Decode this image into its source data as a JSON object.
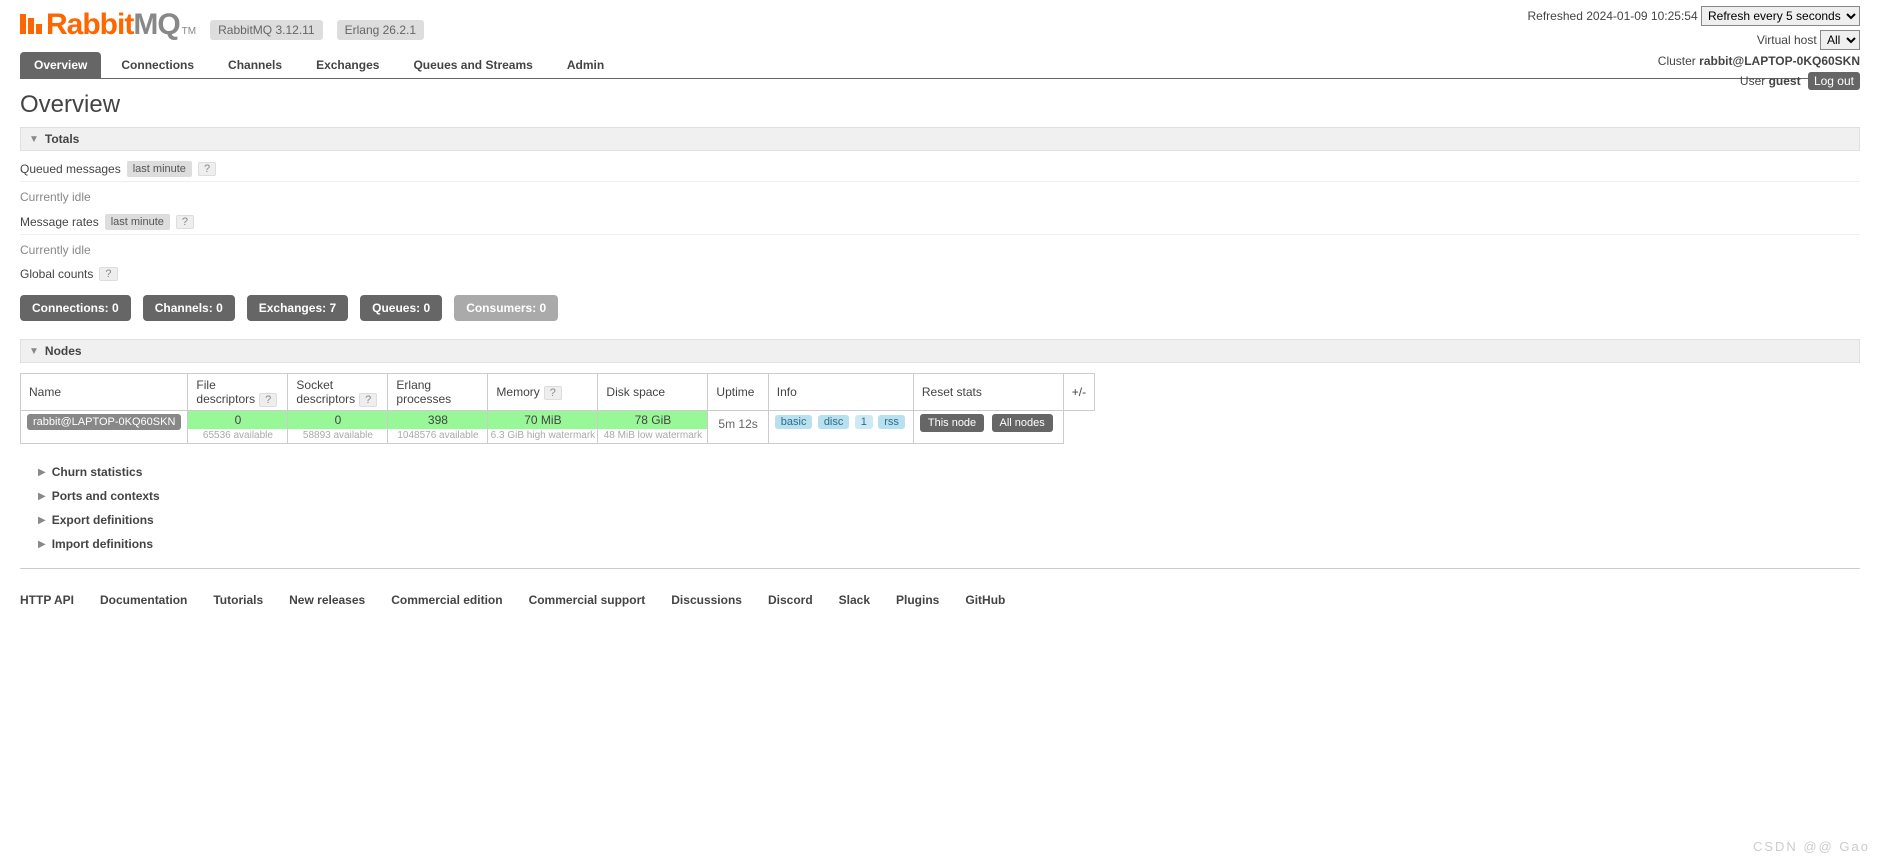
{
  "header": {
    "product": {
      "part1": "Rabbit",
      "part2": "MQ",
      "tm": "TM"
    },
    "versions": {
      "rabbitmq": "RabbitMQ 3.12.11",
      "erlang": "Erlang 26.2.1"
    },
    "refreshed_label": "Refreshed",
    "refreshed_time": "2024-01-09 10:25:54",
    "refresh_select": "Refresh every 5 seconds",
    "vhost_label": "Virtual host",
    "vhost_value": "All",
    "cluster_label": "Cluster",
    "cluster_value": "rabbit@LAPTOP-0KQ60SKN",
    "user_label": "User",
    "user_value": "guest",
    "logout": "Log out"
  },
  "tabs": [
    "Overview",
    "Connections",
    "Channels",
    "Exchanges",
    "Queues and Streams",
    "Admin"
  ],
  "page_title": "Overview",
  "totals": {
    "header": "Totals",
    "queued_label": "Queued messages",
    "last_minute": "last minute",
    "idle": "Currently idle",
    "rates_label": "Message rates",
    "global_label": "Global counts"
  },
  "counts": [
    {
      "label": "Connections:",
      "value": "0",
      "grey": false
    },
    {
      "label": "Channels:",
      "value": "0",
      "grey": false
    },
    {
      "label": "Exchanges:",
      "value": "7",
      "grey": false
    },
    {
      "label": "Queues:",
      "value": "0",
      "grey": false
    },
    {
      "label": "Consumers:",
      "value": "0",
      "grey": true
    }
  ],
  "nodes": {
    "header": "Nodes",
    "columns": [
      "Name",
      "File descriptors",
      "Socket descriptors",
      "Erlang processes",
      "Memory",
      "Disk space",
      "Uptime",
      "Info",
      "Reset stats",
      "+/-"
    ],
    "row": {
      "name": "rabbit@LAPTOP-0KQ60SKN",
      "fd": {
        "value": "0",
        "sub": "65536 available"
      },
      "sd": {
        "value": "0",
        "sub": "58893 available"
      },
      "ep": {
        "value": "398",
        "sub": "1048576 available"
      },
      "mem": {
        "value": "70 MiB",
        "sub": "6.3 GiB high watermark"
      },
      "disk": {
        "value": "78 GiB",
        "sub": "48 MiB low watermark"
      },
      "uptime": "5m 12s",
      "info": [
        "basic",
        "disc",
        "1",
        "rss"
      ],
      "reset": {
        "this": "This node",
        "all": "All nodes"
      },
      "pm": "+/-"
    }
  },
  "collapsibles": [
    "Churn statistics",
    "Ports and contexts",
    "Export definitions",
    "Import definitions"
  ],
  "footer": [
    "HTTP API",
    "Documentation",
    "Tutorials",
    "New releases",
    "Commercial edition",
    "Commercial support",
    "Discussions",
    "Discord",
    "Slack",
    "Plugins",
    "GitHub"
  ],
  "watermark": "CSDN @@        Gao"
}
